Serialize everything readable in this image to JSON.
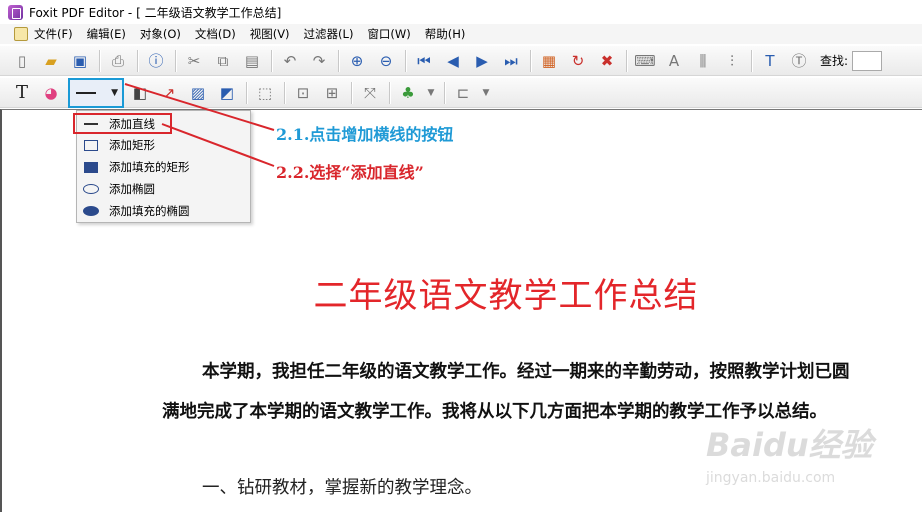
{
  "window": {
    "title": "Foxit PDF Editor - [   二年级语文教学工作总结]"
  },
  "menubar": {
    "items": [
      "文件(F)",
      "编辑(E)",
      "对象(O)",
      "文档(D)",
      "视图(V)",
      "过滤器(L)",
      "窗口(W)",
      "帮助(H)"
    ]
  },
  "toolbar1": {
    "find_label": "查找:"
  },
  "dropdown": {
    "items": [
      "添加直线",
      "添加矩形",
      "添加填充的矩形",
      "添加椭圆",
      "添加填充的椭圆"
    ],
    "selected": "添加直线"
  },
  "annotations": {
    "step1": "2.1.点击增加横线的按钮",
    "step2": "2.2.选择“添加直线”",
    "step1_color": "#1f9ad6",
    "step2_color": "#d9262c"
  },
  "document": {
    "title": "二年级语文教学工作总结",
    "paragraph1": "本学期，我担任二年级的语文教学工作。经过一期来的辛勤劳动，按照教学计划已圆满地完成了本学期的语文教学工作。我将从以下几方面把本学期的教学工作予以总结。",
    "paragraph2": "一、钻研教材，掌握新的教学理念。",
    "title_color": "#e3262a"
  },
  "watermark": {
    "main": "Baidu经验",
    "sub": "jingyan.baidu.com"
  }
}
